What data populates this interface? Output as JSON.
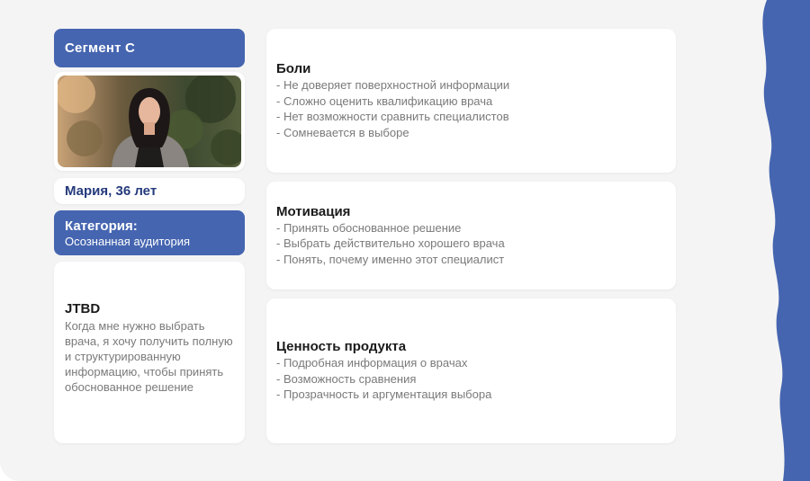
{
  "segment": {
    "label": "Сегмент С"
  },
  "persona": {
    "name": "Мария, 36 лет"
  },
  "category": {
    "title": "Категория:",
    "value": "Осознанная аудитория"
  },
  "jtbd": {
    "title": "JTBD",
    "text": "Когда мне нужно выбрать врача, я хочу получить полную и структурированную информацию, чтобы принять обоснованное решение"
  },
  "pains": {
    "title": "Боли",
    "items": [
      "- Не доверяет поверхностной информации",
      "- Сложно оценить квалификацию врача",
      "- Нет возможности сравнить специалистов",
      "- Сомневается в выборе"
    ]
  },
  "motivation": {
    "title": "Мотивация",
    "items": [
      "- Принять обоснованное решение",
      "- Выбрать действительно хорошего врача",
      "- Понять, почему именно этот специалист"
    ]
  },
  "value": {
    "title": "Ценность продукта",
    "items": [
      "- Подробная информация о врачах",
      "- Возможность сравнения",
      "- Прозрачность и аргументация выбора"
    ]
  },
  "colors": {
    "accent": "#4565b0",
    "name_text": "#243a7c",
    "background": "#f4f4f4"
  }
}
